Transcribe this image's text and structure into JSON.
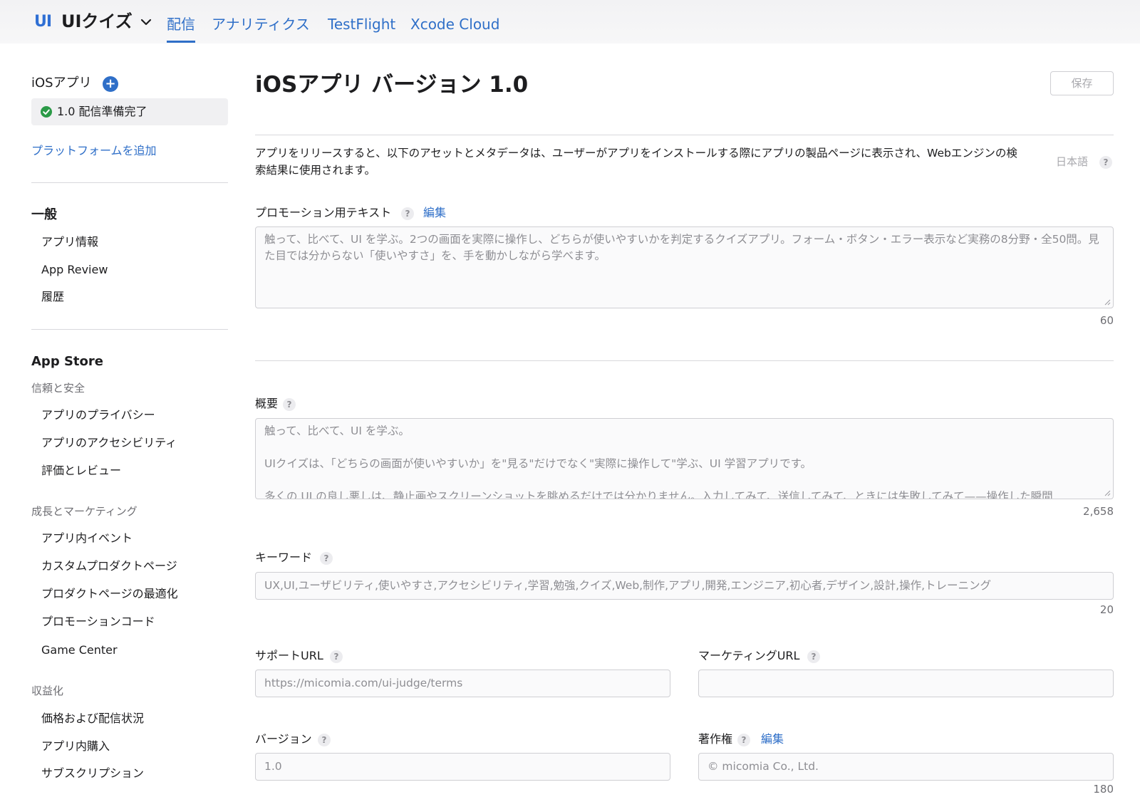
{
  "header": {
    "app_badge": "UI",
    "app_name": "UIクイズ",
    "tabs": [
      {
        "label": "配信",
        "active": true
      },
      {
        "label": "アナリティクス",
        "active": false
      },
      {
        "label": "TestFlight",
        "active": false
      },
      {
        "label": "Xcode Cloud",
        "active": false
      }
    ]
  },
  "sidebar": {
    "platform_title": "iOSアプリ",
    "version_status": "1.0 配信準備完了",
    "add_platform": "プラットフォームを追加",
    "general": {
      "title": "一般",
      "items": [
        "アプリ情報",
        "App Review",
        "履歴"
      ]
    },
    "app_store": {
      "title": "App Store",
      "groups": [
        {
          "title": "信頼と安全",
          "items": [
            "アプリのプライバシー",
            "アプリのアクセシビリティ",
            "評価とレビュー"
          ]
        },
        {
          "title": "成長とマーケティング",
          "items": [
            "アプリ内イベント",
            "カスタムプロダクトページ",
            "プロダクトページの最適化",
            "プロモーションコード",
            "Game Center"
          ]
        },
        {
          "title": "収益化",
          "items": [
            "価格および配信状況",
            "アプリ内購入",
            "サブスクリプション"
          ]
        }
      ]
    }
  },
  "main": {
    "title": "iOSアプリ バージョン 1.0",
    "save_label": "保存",
    "intro": "アプリをリリースすると、以下のアセットとメタデータは、ユーザーがアプリをインストールする際にアプリの製品ページに表示され、Webエンジンの検索結果に使用されます。",
    "language": "日本語",
    "promo": {
      "label": "プロモーション用テキスト",
      "edit": "編集",
      "value": "触って、比べて、UI を学ぶ。2つの画面を実際に操作し、どちらが使いやすいかを判定するクイズアプリ。フォーム・ボタン・エラー表示など実務の8分野・全50問。見た目では分からない「使いやすさ」を、手を動かしながら学べます。",
      "count": "60"
    },
    "description": {
      "label": "概要",
      "value": "触って、比べて、UI を学ぶ。\n\nUIクイズは、「どちらの画面が使いやすいか」を\"見る\"だけでなく\"実際に操作して\"学ぶ、UI 学習アプリです。\n\n多くの UI の良し悪しは、静止画やスクリーンショットを眺めるだけでは分かりません。入力してみて、送信してみて、ときには失敗してみて——操作した瞬間",
      "count": "2,658"
    },
    "keywords": {
      "label": "キーワード",
      "value": "UX,UI,ユーザビリティ,使いやすさ,アクセシビリティ,学習,勉強,クイズ,Web,制作,アプリ,開発,エンジニア,初心者,デザイン,設計,操作,トレーニング",
      "count": "20"
    },
    "support_url": {
      "label": "サポートURL",
      "value": "https://micomia.com/ui-judge/terms"
    },
    "marketing_url": {
      "label": "マーケティングURL",
      "value": ""
    },
    "version": {
      "label": "バージョン",
      "value": "1.0"
    },
    "copyright": {
      "label": "著作権",
      "edit": "編集",
      "value": "© micomia Co., Ltd.",
      "count": "180"
    },
    "help_glyph": "?"
  }
}
